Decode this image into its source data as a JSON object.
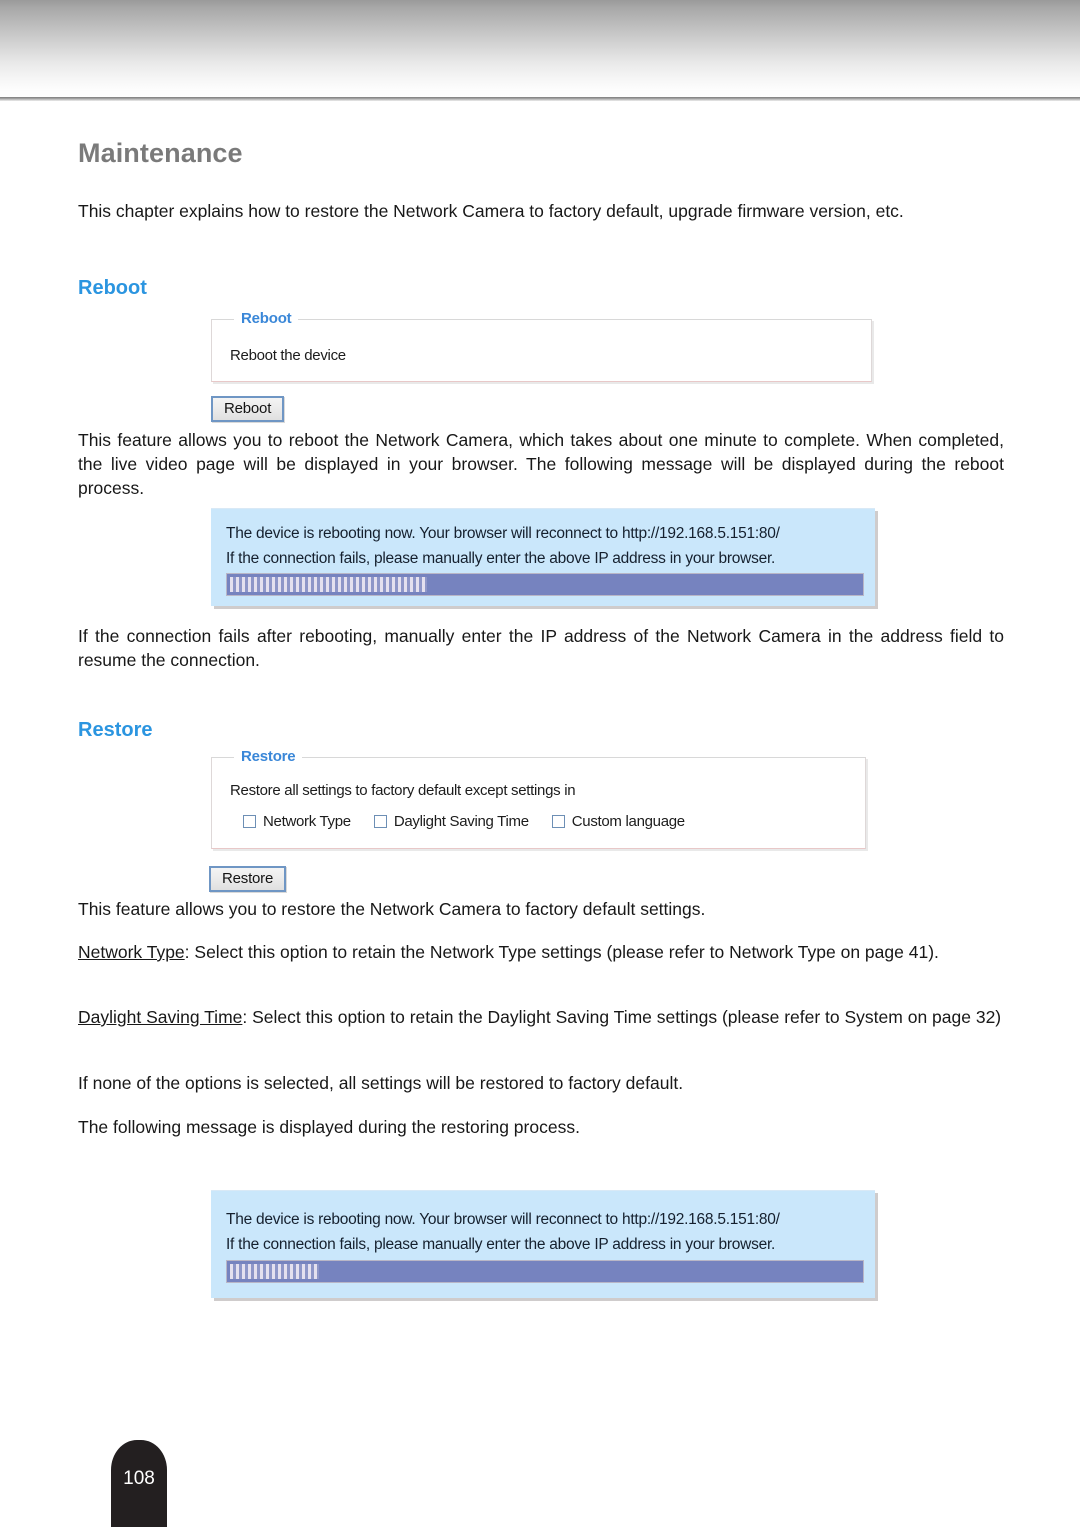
{
  "document": {
    "page_number": "108",
    "title": "Maintenance",
    "intro": "This chapter explains how to restore the Network Camera to factory default, upgrade firmware version, etc."
  },
  "reboot_section": {
    "heading": "Reboot",
    "fieldset": {
      "legend": "Reboot",
      "description": "Reboot the device"
    },
    "button_label": "Reboot",
    "paragraph": "This feature allows you to reboot the Network Camera, which takes about one minute to complete. When completed, the live video page will be displayed in your browser. The following message will be displayed during the reboot process.",
    "message_box": {
      "line1": "The device is rebooting now. Your browser will reconnect to http://192.168.5.151:80/",
      "line2": "If the connection fails, please manually enter the above IP address in your browser.",
      "progress_percent": 31
    },
    "after_paragraph": "If the connection fails after rebooting, manually enter the IP address of the Network Camera in the address field to resume the connection."
  },
  "restore_section": {
    "heading": "Restore",
    "fieldset": {
      "legend": "Restore",
      "description": "Restore all settings to factory default except settings in",
      "checkboxes": [
        {
          "label": "Network Type",
          "checked": false
        },
        {
          "label": "Daylight Saving Time",
          "checked": false
        },
        {
          "label": "Custom language",
          "checked": false
        }
      ]
    },
    "button_label": "Restore",
    "paragraph1": "This feature allows you to restore the Network Camera to factory default settings.",
    "definition1": {
      "term": "Network Type",
      "text": ": Select this option to retain the Network Type settings (please refer to Network Type on page 41)."
    },
    "definition2": {
      "term": "Daylight Saving Time",
      "text": ": Select this option to retain the Daylight Saving Time settings (please refer to System on page 32)"
    },
    "paragraph2": "If none of the options is selected, all settings will be restored to factory default.",
    "paragraph3": "The following message is displayed during the restoring process.",
    "message_box": {
      "line1": "The device is rebooting now. Your browser will reconnect to http://192.168.5.151:80/",
      "line2": "If the connection fails, please manually enter the above IP address in your browser.",
      "progress_percent": 14
    }
  },
  "colors": {
    "heading_blue": "#2b95e0",
    "title_gray": "#7a7a7a",
    "message_bg": "#cae7fb",
    "progress_track": "#7683bf"
  }
}
